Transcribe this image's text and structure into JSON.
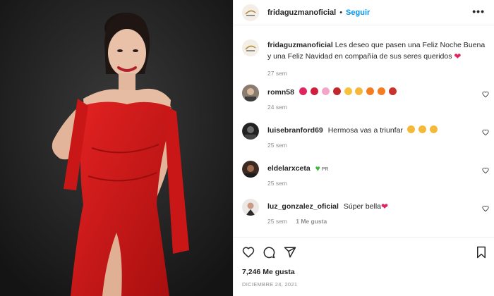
{
  "post": {
    "image_alt": "Woman in a red off-shoulder dress against a dark studio background",
    "colors": {
      "background": "#1d1d1d",
      "dress": "#d31a1a",
      "follow": "#0095f6",
      "meta": "#8e8e8e"
    }
  },
  "header": {
    "username": "fridaguzmanoficial",
    "separator": "•",
    "follow_label": "Seguir",
    "more_label": "•••"
  },
  "caption": {
    "username": "fridaguzmanoficial",
    "text": "Les deseo que pasen una Feliz Noche Buena y una Feliz Navidad en compañía de sus seres queridos",
    "emoji": "heart",
    "time": "27 sem"
  },
  "comments": [
    {
      "username": "romn58",
      "text": "",
      "emojis": [
        "heart-arrow",
        "kiss",
        "flower",
        "rose",
        "heart-eyes",
        "star-face",
        "fire",
        "fire",
        "gift"
      ],
      "time": "24 sem",
      "likes": ""
    },
    {
      "username": "luisebranford69",
      "text": "Hermosa vas a triunfar",
      "emojis": [
        "clap",
        "clap",
        "clap"
      ],
      "time": "25 sem",
      "likes": ""
    },
    {
      "username": "eldelarxceta",
      "text": "",
      "emojis": [
        "green-heart"
      ],
      "suffix": "PR",
      "time": "25 sem",
      "likes": ""
    },
    {
      "username": "luz_gonzalez_oficial",
      "text": "Súper bella",
      "emojis": [
        "heart"
      ],
      "time": "25 sem",
      "likes": "1 Me gusta"
    }
  ],
  "actions": {
    "like_icon": "heart-icon",
    "comment_icon": "comment-icon",
    "share_icon": "send-icon",
    "save_icon": "bookmark-icon",
    "likes": "7,246 Me gusta",
    "date": "DICIEMBRE 24, 2021"
  }
}
